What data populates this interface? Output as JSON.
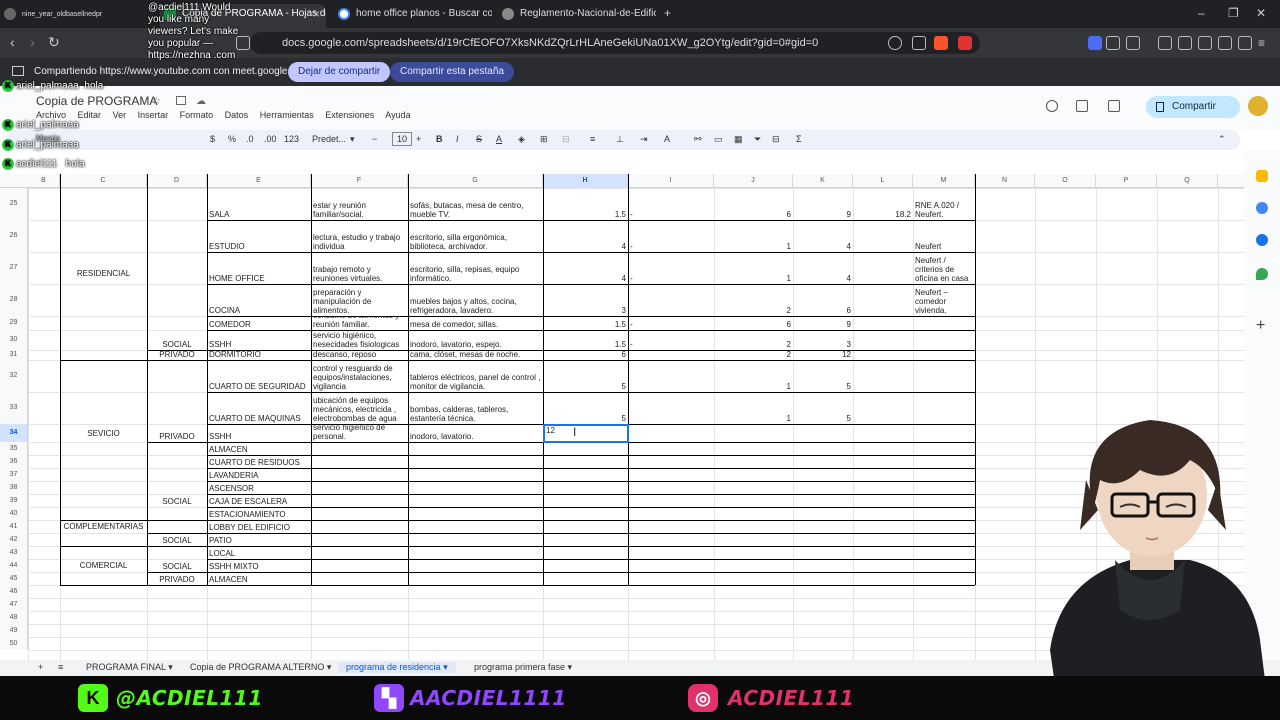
{
  "browser": {
    "tabs": [
      {
        "title": "Copia de PROGRAMA - Hojas de"
      },
      {
        "title": "home office planos - Buscar con Goo"
      },
      {
        "title": "Reglamento-Nacional-de-Edificacion"
      }
    ],
    "url": "docs.google.com/spreadsheets/d/19rCfEOFO7XksNKdZQrLrHLAneGekiUNa01XW_g2OYtg/edit?gid=0#gid=0",
    "new_tab": "+"
  },
  "screenshare": {
    "sharing_text": "Compartiendo https://www.youtube.com con meet.google.com",
    "stop_button": "Dejar de compartir",
    "share_tab_button": "Compartir esta pestaña"
  },
  "sheets": {
    "doc_title": "Copia de PROGRAMA",
    "menus": [
      "Archivo",
      "Editar",
      "Ver",
      "Insertar",
      "Formato",
      "Datos",
      "Herramientas",
      "Extensiones",
      "Ayuda"
    ],
    "share_button": "Compartir",
    "toolbar": {
      "currency": "$",
      "percent": "%",
      "dec_down": ".0",
      "dec_up": ".00",
      "number_format": "123",
      "font": "Predet...",
      "font_size": "10",
      "bold": "B",
      "italic": "I",
      "strike": "S",
      "font_color": "A",
      "text_color_label": "A",
      "sigma": "Σ"
    },
    "columns": [
      "B",
      "C",
      "D",
      "E",
      "F",
      "G",
      "H",
      "I",
      "J",
      "K",
      "L",
      "M",
      "N",
      "O",
      "P",
      "Q"
    ],
    "selected_column": "H",
    "row_numbers": [
      "25",
      "26",
      "27",
      "28",
      "29",
      "30",
      "31",
      "32",
      "33",
      "34",
      "35",
      "36",
      "37",
      "38",
      "39",
      "40",
      "41",
      "42",
      "43",
      "44",
      "45",
      "46",
      "47",
      "48",
      "49",
      "50"
    ],
    "selected_row": "34",
    "merged_labels": {
      "residencial": "RESIDENCIAL",
      "social_res": "SOCIAL",
      "privado_res": "PRIVADO",
      "sevicio": "SEVICIO",
      "privado_sev": "PRIVADO",
      "social_sev": "SOCIAL",
      "complementarias": "COMPLEMENTARIAS",
      "social_comp": "SOCIAL",
      "comercial": "COMERCIAL",
      "social_com": "SOCIAL",
      "privado_com": "PRIVADO"
    },
    "rows": [
      {
        "e": "SALA",
        "f": "estar y reunión familiar/social.",
        "g": "sofás, butacas, mesa de centro, mueble TV.",
        "h": "1.5",
        "i": "-",
        "j": "6",
        "k": "9",
        "l": "18.2",
        "m": "RNE A.020 / Neufert."
      },
      {
        "e": "ESTUDIO",
        "f": "lectura, estudio y trabajo individua",
        "g": "escritorio, silla ergonómica, biblioteca, archivador.",
        "h": "4",
        "i": "-",
        "j": "1",
        "k": "4",
        "l": "",
        "m": "Neufert"
      },
      {
        "e": "HOME OFFICE",
        "f": "trabajo remoto y reuniones virtuales.",
        "g": "escritorio, silla, repisas, equipo informático.",
        "h": "4",
        "i": "-",
        "j": "1",
        "k": "4",
        "l": "",
        "m": "Neufert / criterios de oficina en casa"
      },
      {
        "e": "COCINA",
        "f": "preparación y manipulación de alimentos.",
        "g": "muebles bajos y altos, cocina, refrigeradora, lavadero.",
        "h": "3",
        "i": "",
        "j": "2",
        "k": "6",
        "l": "",
        "m": "Neufert – comedor vivienda."
      },
      {
        "e": "COMEDOR",
        "f": "consumo de alimentos y reunión familiar.",
        "g": "mesa de comedor, sillas.",
        "h": "1.5",
        "i": "-",
        "j": "6",
        "k": "9",
        "l": "",
        "m": ""
      },
      {
        "e": "SSHH",
        "f": "servicio higiénico, nesecidades fisiologicas",
        "g": "inodoro, lavatorio, espejo.",
        "h": "1.5",
        "i": "-",
        "j": "2",
        "k": "3",
        "l": "",
        "m": ""
      },
      {
        "e": "DORMITORIO",
        "f": "descanso, reposo",
        "g": "cama, clóset, mesas de noche.",
        "h": "6",
        "i": "",
        "j": "2",
        "k": "12",
        "l": "",
        "m": ""
      },
      {
        "e": "CUARTO DE SEGURIDAD",
        "f": "control y resguardo de equipos/instalaciones, vigilancia",
        "g": "tableros eléctricos, panel de control , monitor de vigilancia.",
        "h": "5",
        "i": "",
        "j": "1",
        "k": "5",
        "l": "",
        "m": ""
      },
      {
        "e": "CUARTO DE MAQUINAS",
        "f": "ubicación de equipos mecánicos, electricida , electrobombas de agua",
        "g": "bombas, calderas, tableros, estantería técnica.",
        "h": "5",
        "i": "",
        "j": "1",
        "k": "5",
        "l": "",
        "m": ""
      },
      {
        "e": "SSHH",
        "f": "servicio higiénico de personal.",
        "g": "inodoro, lavatorio.",
        "h": "12",
        "i": "",
        "j": "",
        "k": "",
        "l": "",
        "m": ""
      },
      {
        "e": "ALMACEN"
      },
      {
        "e": "CUARTO DE RESIDUOS"
      },
      {
        "e": "LAVANDERIA"
      },
      {
        "e": "ASCENSOR"
      },
      {
        "e": "CAJA DE ESCALERA"
      },
      {
        "e": "ESTACIONAMIENTO"
      },
      {
        "e": "LOBBY DEL EDIFICIO"
      },
      {
        "e": "PATIO"
      },
      {
        "e": "LOCAL"
      },
      {
        "e": "SSHH MIXTO"
      },
      {
        "e": "ALMACEN"
      }
    ],
    "sheet_tabs": [
      "PROGRAMA FINAL",
      "Copia de PROGRAMA ALTERNO",
      "programa de residencia",
      "programa primera fase"
    ],
    "active_sheet": "programa de residencia"
  },
  "chat": {
    "highlight": "@acdiel111 Would you like many viewers? Let's make you popular — https://nezhna .com",
    "top_line": "nine_year_oldbasellnedpr",
    "messages": [
      {
        "user": "ariel_palmaaa",
        "text": "hola"
      },
      {
        "user": "ariel_palmaaa",
        "text": ""
      },
      {
        "user": "ariel_palmaaa",
        "text": ""
      },
      {
        "user": "acdiel111",
        "text": "hola"
      }
    ],
    "menus_ghost": "Menús"
  },
  "footer": {
    "kick": "@ACDIEL111",
    "twitch": "AACDIEL1111",
    "instagram": "ACDIEL111"
  },
  "colors": {
    "kick_green": "#53fc18",
    "twitch_purple": "#9146ff",
    "insta_pink": "#e1306c",
    "selection_blue": "#1a73e8"
  }
}
